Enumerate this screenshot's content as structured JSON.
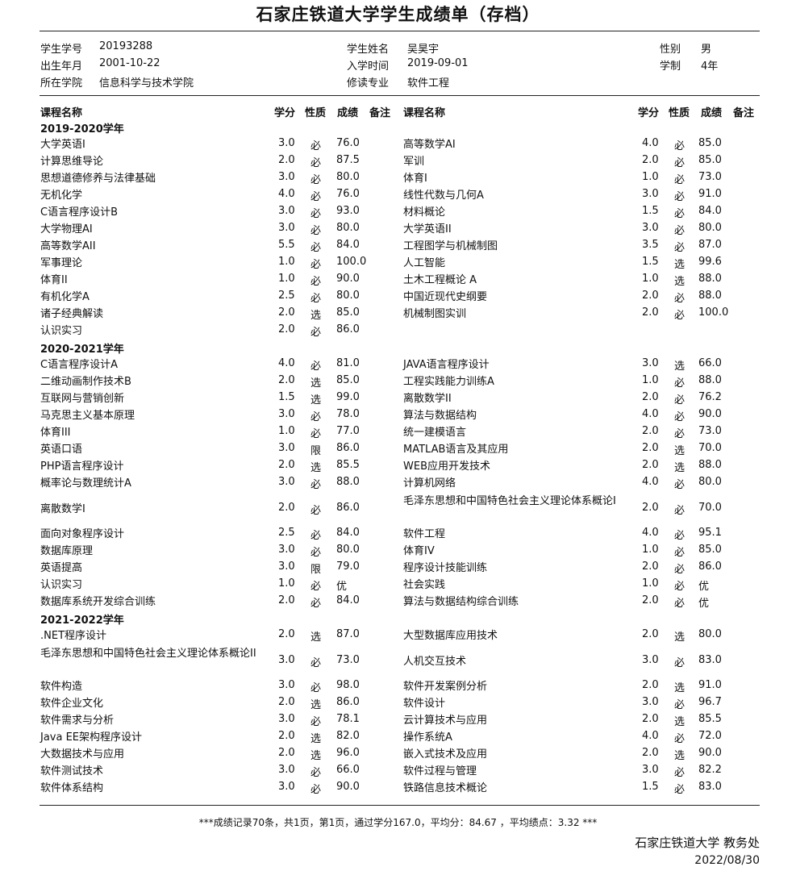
{
  "title": "石家庄铁道大学学生成绩单（存档）",
  "student": [
    {
      "label": "学生学号",
      "value": "20193288"
    },
    {
      "label": "学生姓名",
      "value": "吴昊宇"
    },
    {
      "label": "性别",
      "value": "男"
    },
    {
      "label": "出生年月",
      "value": "2001-10-22"
    },
    {
      "label": "入学时间",
      "value": "2019-09-01"
    },
    {
      "label": "学制",
      "value": "4年"
    },
    {
      "label": "所在学院",
      "value": "信息科学与技术学院"
    },
    {
      "label": "修读专业",
      "value": "软件工程"
    }
  ],
  "headers": {
    "course": "课程名称",
    "credit": "学分",
    "type": "性质",
    "score": "成绩",
    "note": "备注"
  },
  "sections": [
    {
      "year": "2019-2020学年",
      "rows": [
        [
          [
            "大学英语I",
            "3.0",
            "必",
            "76.0"
          ],
          [
            "高等数学AI",
            "4.0",
            "必",
            "85.0"
          ]
        ],
        [
          [
            "计算思维导论",
            "2.0",
            "必",
            "87.5"
          ],
          [
            "军训",
            "2.0",
            "必",
            "85.0"
          ]
        ],
        [
          [
            "思想道德修养与法律基础",
            "3.0",
            "必",
            "80.0"
          ],
          [
            "体育I",
            "1.0",
            "必",
            "73.0"
          ]
        ],
        [
          [
            "无机化学",
            "4.0",
            "必",
            "76.0"
          ],
          [
            "线性代数与几何A",
            "3.0",
            "必",
            "91.0"
          ]
        ],
        [
          [
            "C语言程序设计B",
            "3.0",
            "必",
            "93.0"
          ],
          [
            "材料概论",
            "1.5",
            "必",
            "84.0"
          ]
        ],
        [
          [
            "大学物理AI",
            "3.0",
            "必",
            "80.0"
          ],
          [
            "大学英语II",
            "3.0",
            "必",
            "80.0"
          ]
        ],
        [
          [
            "高等数学AII",
            "5.5",
            "必",
            "84.0"
          ],
          [
            "工程图学与机械制图",
            "3.5",
            "必",
            "87.0"
          ]
        ],
        [
          [
            "军事理论",
            "1.0",
            "必",
            "100.0"
          ],
          [
            "人工智能",
            "1.5",
            "选",
            "99.6"
          ]
        ],
        [
          [
            "体育II",
            "1.0",
            "必",
            "90.0"
          ],
          [
            "土木工程概论 A",
            "1.0",
            "选",
            "88.0"
          ]
        ],
        [
          [
            "有机化学A",
            "2.5",
            "必",
            "80.0"
          ],
          [
            "中国近现代史纲要",
            "2.0",
            "必",
            "88.0"
          ]
        ],
        [
          [
            "诸子经典解读",
            "2.0",
            "选",
            "85.0"
          ],
          [
            "机械制图实训",
            "2.0",
            "必",
            "100.0"
          ]
        ],
        [
          [
            "认识实习",
            "2.0",
            "必",
            "86.0"
          ],
          null
        ]
      ]
    },
    {
      "year": "2020-2021学年",
      "rows": [
        [
          [
            "C语言程序设计A",
            "4.0",
            "必",
            "81.0"
          ],
          [
            "JAVA语言程序设计",
            "3.0",
            "选",
            "66.0"
          ]
        ],
        [
          [
            "二维动画制作技术B",
            "2.0",
            "选",
            "85.0"
          ],
          [
            "工程实践能力训练A",
            "1.0",
            "必",
            "88.0"
          ]
        ],
        [
          [
            "互联网与营销创新",
            "1.5",
            "选",
            "99.0"
          ],
          [
            "离散数学II",
            "2.0",
            "必",
            "76.2"
          ]
        ],
        [
          [
            "马克思主义基本原理",
            "3.0",
            "必",
            "78.0"
          ],
          [
            "算法与数据结构",
            "4.0",
            "必",
            "90.0"
          ]
        ],
        [
          [
            "体育III",
            "1.0",
            "必",
            "77.0"
          ],
          [
            "统一建模语言",
            "2.0",
            "必",
            "73.0"
          ]
        ],
        [
          [
            "英语口语",
            "3.0",
            "限",
            "86.0"
          ],
          [
            "MATLAB语言及其应用",
            "2.0",
            "选",
            "70.0"
          ]
        ],
        [
          [
            "PHP语言程序设计",
            "2.0",
            "选",
            "85.5"
          ],
          [
            "WEB应用开发技术",
            "2.0",
            "选",
            "88.0"
          ]
        ],
        [
          [
            "概率论与数理统计A",
            "3.0",
            "必",
            "88.0"
          ],
          [
            "计算机网络",
            "4.0",
            "必",
            "80.0"
          ]
        ],
        [
          [
            "离散数学I",
            "2.0",
            "必",
            "86.0"
          ],
          [
            "毛泽东思想和中国特色社会主义理论体系概论I",
            "2.0",
            "必",
            "70.0"
          ]
        ],
        [
          [
            "面向对象程序设计",
            "2.5",
            "必",
            "84.0"
          ],
          [
            "软件工程",
            "4.0",
            "必",
            "95.1"
          ]
        ],
        [
          [
            "数据库原理",
            "3.0",
            "必",
            "80.0"
          ],
          [
            "体育IV",
            "1.0",
            "必",
            "85.0"
          ]
        ],
        [
          [
            "英语提高",
            "3.0",
            "限",
            "79.0"
          ],
          [
            "程序设计技能训练",
            "2.0",
            "必",
            "86.0"
          ]
        ],
        [
          [
            "认识实习",
            "1.0",
            "必",
            "优"
          ],
          [
            "社会实践",
            "1.0",
            "必",
            "优"
          ]
        ],
        [
          [
            "数据库系统开发综合训练",
            "2.0",
            "必",
            "84.0"
          ],
          [
            "算法与数据结构综合训练",
            "2.0",
            "必",
            "优"
          ]
        ]
      ]
    },
    {
      "year": "2021-2022学年",
      "rows": [
        [
          [
            ".NET程序设计",
            "2.0",
            "选",
            "87.0"
          ],
          [
            "大型数据库应用技术",
            "2.0",
            "选",
            "80.0"
          ]
        ],
        [
          [
            "毛泽东思想和中国特色社会主义理论体系概论II",
            "3.0",
            "必",
            "73.0"
          ],
          [
            "人机交互技术",
            "3.0",
            "必",
            "83.0"
          ]
        ],
        [
          [
            "软件构造",
            "3.0",
            "必",
            "98.0"
          ],
          [
            "软件开发案例分析",
            "2.0",
            "选",
            "91.0"
          ]
        ],
        [
          [
            "软件企业文化",
            "2.0",
            "选",
            "86.0"
          ],
          [
            "软件设计",
            "3.0",
            "必",
            "96.7"
          ]
        ],
        [
          [
            "软件需求与分析",
            "3.0",
            "必",
            "78.1"
          ],
          [
            "云计算技术与应用",
            "2.0",
            "选",
            "85.5"
          ]
        ],
        [
          [
            "Java EE架构程序设计",
            "2.0",
            "选",
            "82.0"
          ],
          [
            "操作系统A",
            "4.0",
            "必",
            "72.0"
          ]
        ],
        [
          [
            "大数据技术与应用",
            "2.0",
            "选",
            "96.0"
          ],
          [
            "嵌入式技术及应用",
            "2.0",
            "选",
            "90.0"
          ]
        ],
        [
          [
            "软件测试技术",
            "3.0",
            "必",
            "66.0"
          ],
          [
            "软件过程与管理",
            "3.0",
            "必",
            "82.2"
          ]
        ],
        [
          [
            "软件体系结构",
            "3.0",
            "必",
            "90.0"
          ],
          [
            "铁路信息技术概论",
            "1.5",
            "必",
            "83.0"
          ]
        ]
      ]
    }
  ],
  "footer": "***成绩记录70条，共1页，第1页，通过学分167.0，平均分：84.67 ，平均绩点：3.32 ***",
  "org": "石家庄铁道大学 教务处",
  "date": "2022/08/30"
}
